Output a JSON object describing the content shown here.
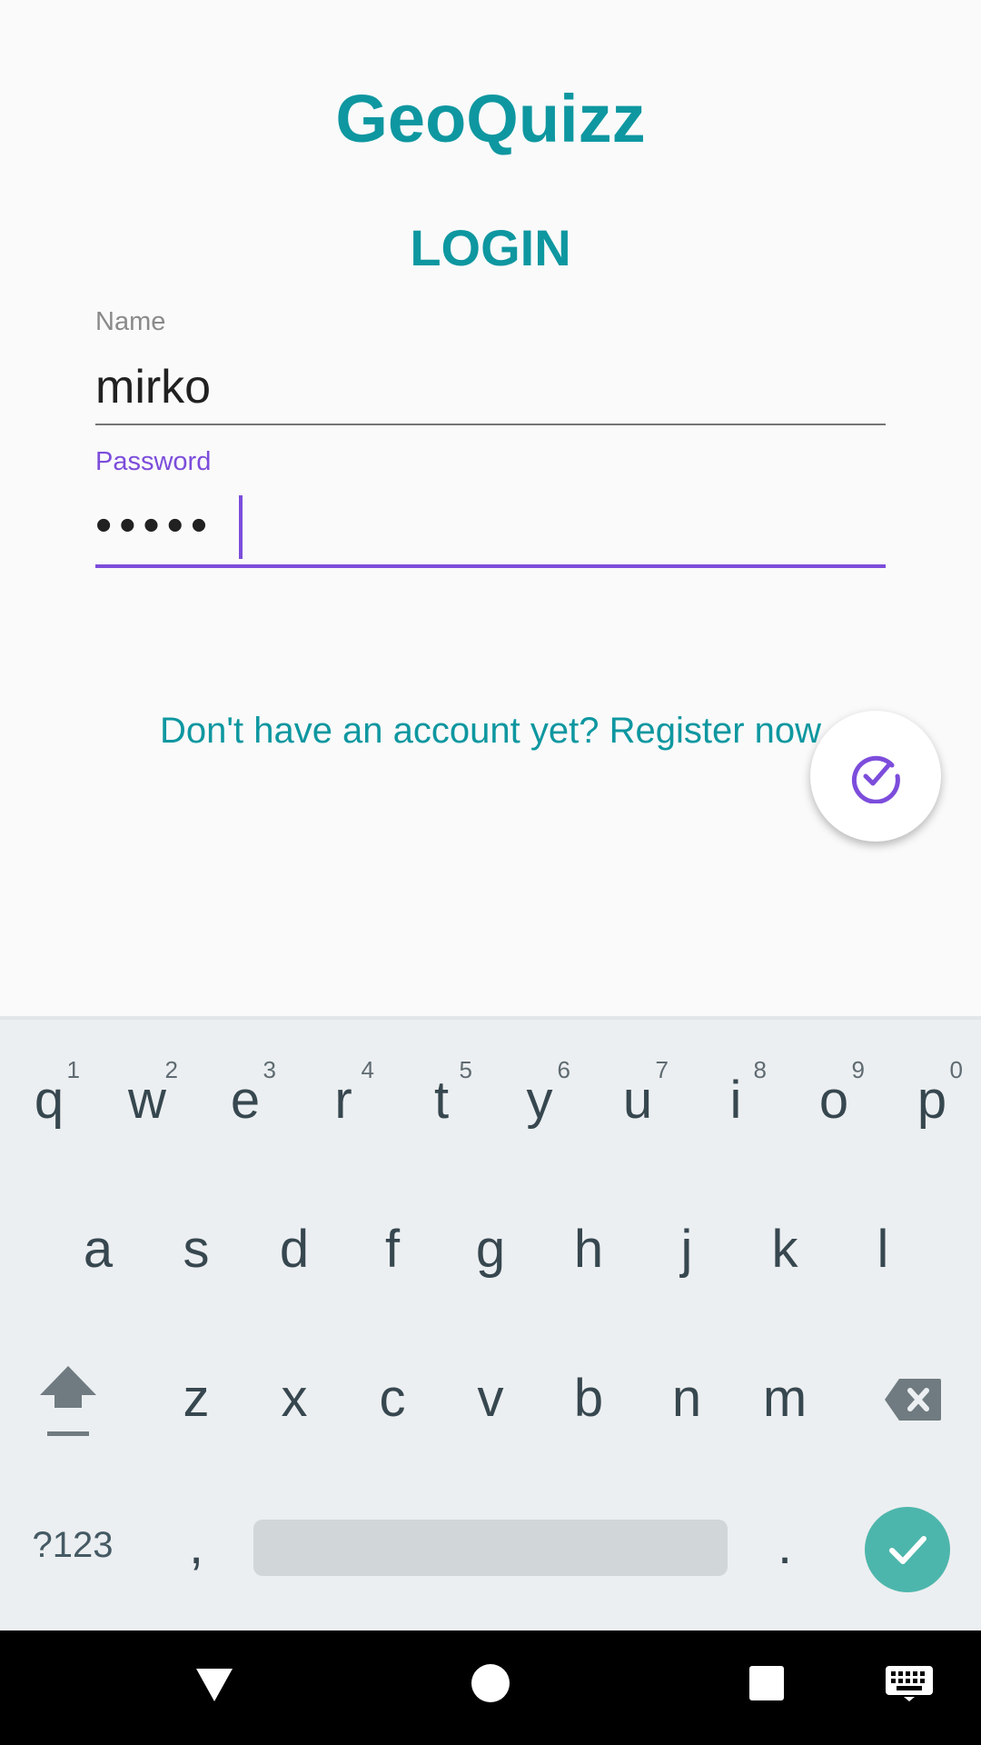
{
  "app": {
    "title": "GeoQuizz",
    "heading": "LOGIN"
  },
  "form": {
    "name_label": "Name",
    "name_value": "mirko",
    "password_label": "Password",
    "password_value": "•••••"
  },
  "register_link": "Don't have an account yet? Register now",
  "fab": {
    "icon": "check-circle-icon"
  },
  "keyboard": {
    "row1": [
      {
        "key": "q",
        "hint": "1"
      },
      {
        "key": "w",
        "hint": "2"
      },
      {
        "key": "e",
        "hint": "3"
      },
      {
        "key": "r",
        "hint": "4"
      },
      {
        "key": "t",
        "hint": "5"
      },
      {
        "key": "y",
        "hint": "6"
      },
      {
        "key": "u",
        "hint": "7"
      },
      {
        "key": "i",
        "hint": "8"
      },
      {
        "key": "o",
        "hint": "9"
      },
      {
        "key": "p",
        "hint": "0"
      }
    ],
    "row2": [
      "a",
      "s",
      "d",
      "f",
      "g",
      "h",
      "j",
      "k",
      "l"
    ],
    "row3": [
      "z",
      "x",
      "c",
      "v",
      "b",
      "n",
      "m"
    ],
    "symbols_label": "?123",
    "comma": ",",
    "period": "."
  },
  "colors": {
    "accent": "#0e97a0",
    "focus": "#7c4ddb",
    "keyboard_bg": "#eceff1",
    "enter": "#4db6ac"
  }
}
